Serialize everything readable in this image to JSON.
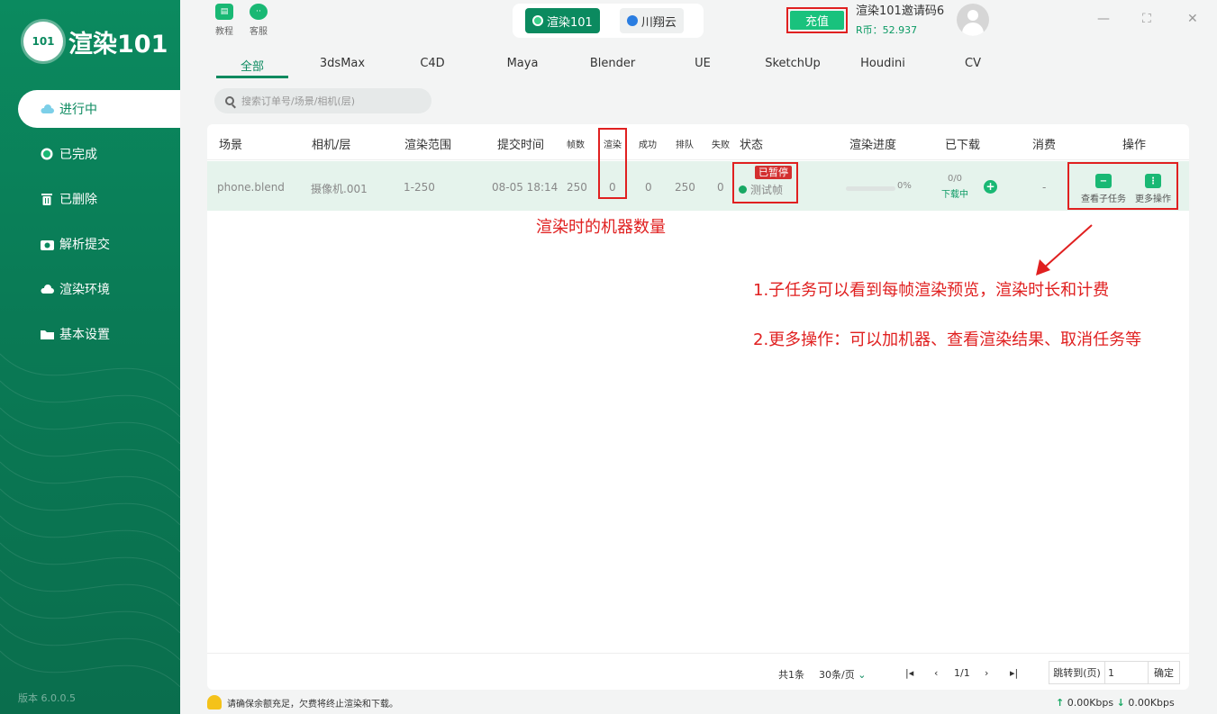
{
  "app": {
    "logo_badge": "101",
    "logo_text": "渲染101",
    "version": "版本 6.0.0.5"
  },
  "sidebar": {
    "items": [
      {
        "label": "进行中",
        "icon": "cloud-icon",
        "active": true
      },
      {
        "label": "已完成",
        "icon": "check-circle-icon",
        "active": false
      },
      {
        "label": "已删除",
        "icon": "trash-icon",
        "active": false
      },
      {
        "label": "解析提交",
        "icon": "camera-icon",
        "active": false
      },
      {
        "label": "渲染环境",
        "icon": "cloud-icon",
        "active": false
      },
      {
        "label": "基本设置",
        "icon": "folder-icon",
        "active": false
      }
    ]
  },
  "top": {
    "tutorial_label": "教程",
    "service_label": "客服",
    "platforms": [
      {
        "label": "渲染101",
        "active": true
      },
      {
        "label": "川翔云",
        "active": false
      }
    ],
    "recharge_label": "充值",
    "user_name": "渲染101邀请码6",
    "balance": "R币：52.937"
  },
  "tabs": [
    "全部",
    "3dsMax",
    "C4D",
    "Maya",
    "Blender",
    "UE",
    "SketchUp",
    "Houdini",
    "CV"
  ],
  "search": {
    "placeholder": "搜索订单号/场景/相机(层)"
  },
  "table": {
    "headers": [
      "场景",
      "相机/层",
      "渲染范围",
      "提交时间",
      "帧数",
      "渲染",
      "成功",
      "排队",
      "失败",
      "状态",
      "渲染进度",
      "已下载",
      "消费",
      "操作"
    ],
    "row": {
      "scene": "phone.blend",
      "camera": "摄像机.001",
      "range": "1-250",
      "time": "08-05 18:14",
      "frames": "250",
      "rendering": "0",
      "success": "0",
      "queue": "250",
      "failed": "0",
      "badge": "已暂停",
      "status": "测试帧",
      "progress_text": "0%",
      "progress": 0,
      "downloaded": "0/0",
      "download_status": "下载中",
      "cost": "-",
      "op1": "查看子任务",
      "op2": "更多操作"
    }
  },
  "footer": {
    "total": "共1条",
    "page_size": "30条/页",
    "page": "1/1",
    "jump_label": "跳转到(页)",
    "jump_value": "1",
    "confirm": "确定"
  },
  "annotations": {
    "a1": "渲染时的机器数量",
    "a2": "1.子任务可以看到每帧渲染预览，渲染时长和计费",
    "a3": "2.更多操作：可以加机器、查看渲染结果、取消任务等"
  },
  "bottom": {
    "notice": "请确保余额充足，欠费将终止渲染和下载。",
    "up_speed": "0.00Kbps",
    "down_speed": "0.00Kbps"
  },
  "colors": {
    "brand": "#0b8a5f",
    "accent": "#19b874",
    "annotation": "#e02020"
  }
}
